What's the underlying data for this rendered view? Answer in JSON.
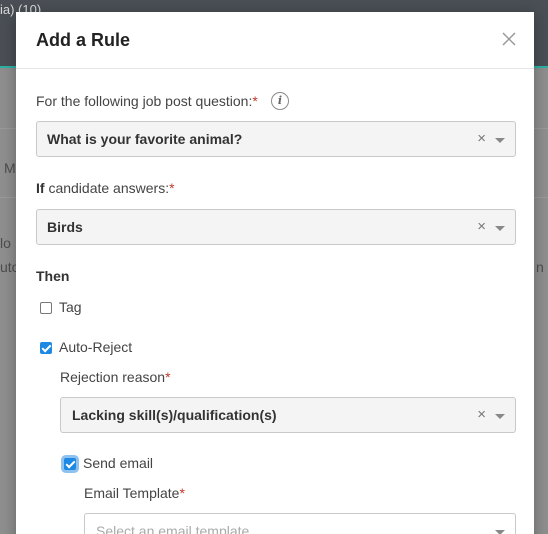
{
  "background": {
    "topbar_fragment": "ia) (10)",
    "frag_m": "M",
    "frag_lo": "lo",
    "frag_uto": "uto",
    "frag_n": "n"
  },
  "modal": {
    "title": "Add a Rule",
    "question_label": "For the following job post question:",
    "question_value": "What is your favorite animal?",
    "answer_label_bold": "If",
    "answer_label_rest": " candidate answers:",
    "answer_value": "Birds",
    "then_label": "Then",
    "tag_label": "Tag",
    "tag_checked": false,
    "autoreject_label": "Auto-Reject",
    "autoreject_checked": true,
    "rejection_reason_label": "Rejection reason",
    "rejection_reason_value": "Lacking skill(s)/qualification(s)",
    "send_email_label": "Send email",
    "send_email_checked": true,
    "email_template_label": "Email Template",
    "email_template_placeholder": "Select an email template",
    "required_marker": "*",
    "clear_glyph": "×"
  }
}
